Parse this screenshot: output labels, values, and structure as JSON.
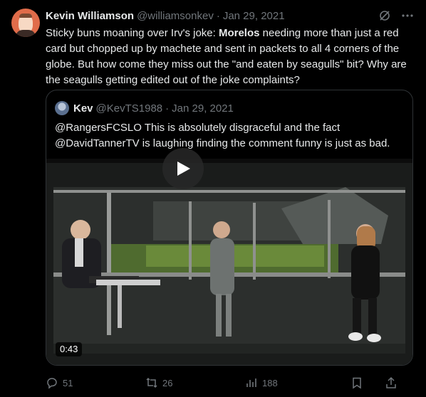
{
  "author": {
    "name": "Kevin Williamson",
    "handle": "@williamsonkev",
    "separator": "·",
    "date": "Jan 29, 2021"
  },
  "tweet": {
    "text_before": "Sticky buns moaning over Irv's joke: ",
    "text_bold": "Morelos",
    "text_after": " needing more than just a red card but chopped up by machete and sent in packets to all 4 corners of the globe. But how come they miss out the \"and eaten by seagulls\" bit? Why are the seagulls getting edited out of the joke complaints?"
  },
  "quote": {
    "name": "Kev",
    "handle": "@KevTS1988",
    "separator": "·",
    "date": "Jan 29, 2021",
    "text": "@RangersFCSLO This is absolutely disgraceful and the fact @DavidTannerTV is laughing finding the comment funny is just as bad.",
    "video_duration": "0:43"
  },
  "actions": {
    "replies": "51",
    "retweets": "26",
    "views": "188"
  },
  "colors": {
    "background": "#000000",
    "text": "#e7e9ea",
    "muted": "#71767b",
    "border": "#2f3336"
  },
  "icons": [
    "grok-icon",
    "more-icon",
    "reply-icon",
    "retweet-icon",
    "views-icon",
    "bookmark-icon",
    "share-icon",
    "play-icon"
  ]
}
